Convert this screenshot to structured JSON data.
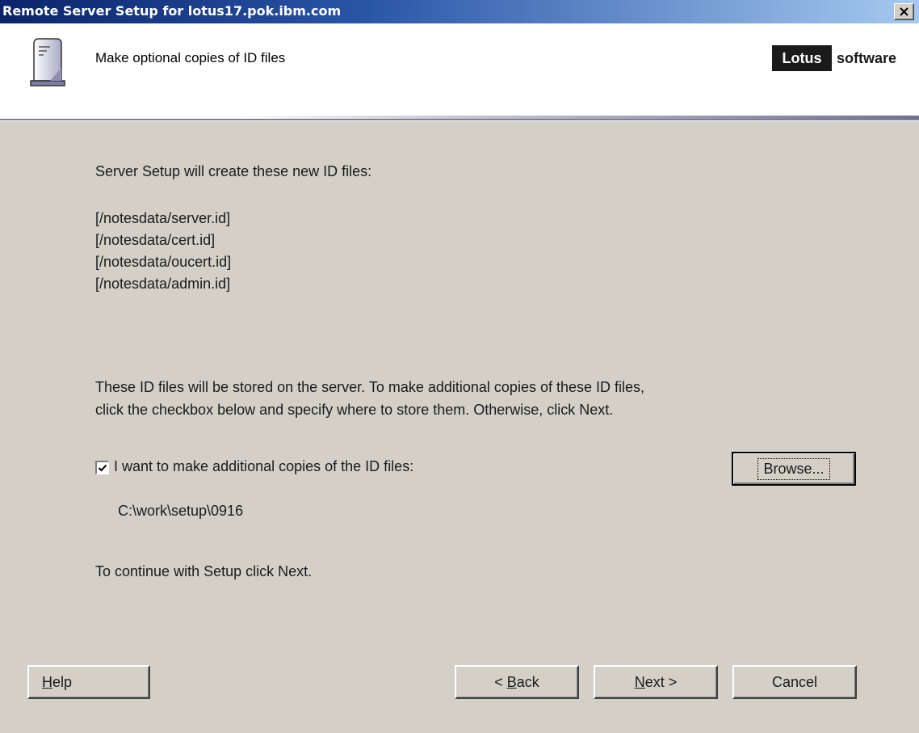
{
  "window": {
    "title": "Remote Server Setup for lotus17.pok.ibm.com"
  },
  "header": {
    "title": "Make optional copies of ID files",
    "brand_lotus": "Lotus",
    "brand_software": "software"
  },
  "body": {
    "intro": "Server Setup will create these new ID files:",
    "id_files": [
      "[/notesdata/server.id]",
      "[/notesdata/cert.id]",
      "[/notesdata/oucert.id]",
      "[/notesdata/admin.id]"
    ],
    "info_line1": "These ID files will be stored on the server. To make additional copies of these ID files,",
    "info_line2": "click the checkbox below and specify where to store them. Otherwise, click Next.",
    "checkbox_label": "I want to make additional copies of the ID files:",
    "checkbox_checked": true,
    "copy_path": "C:\\work\\setup\\0916",
    "continue_text": "To continue with Setup click Next."
  },
  "buttons": {
    "browse": "Browse...",
    "help_mnemonic": "H",
    "help_rest": "elp",
    "back_prefix": "< ",
    "back_mnemonic": "B",
    "back_rest": "ack",
    "next_mnemonic": "N",
    "next_rest": "ext >",
    "cancel": "Cancel"
  },
  "icons": {
    "close": "close-icon",
    "server": "server-icon",
    "checkmark": "checkmark-icon"
  }
}
